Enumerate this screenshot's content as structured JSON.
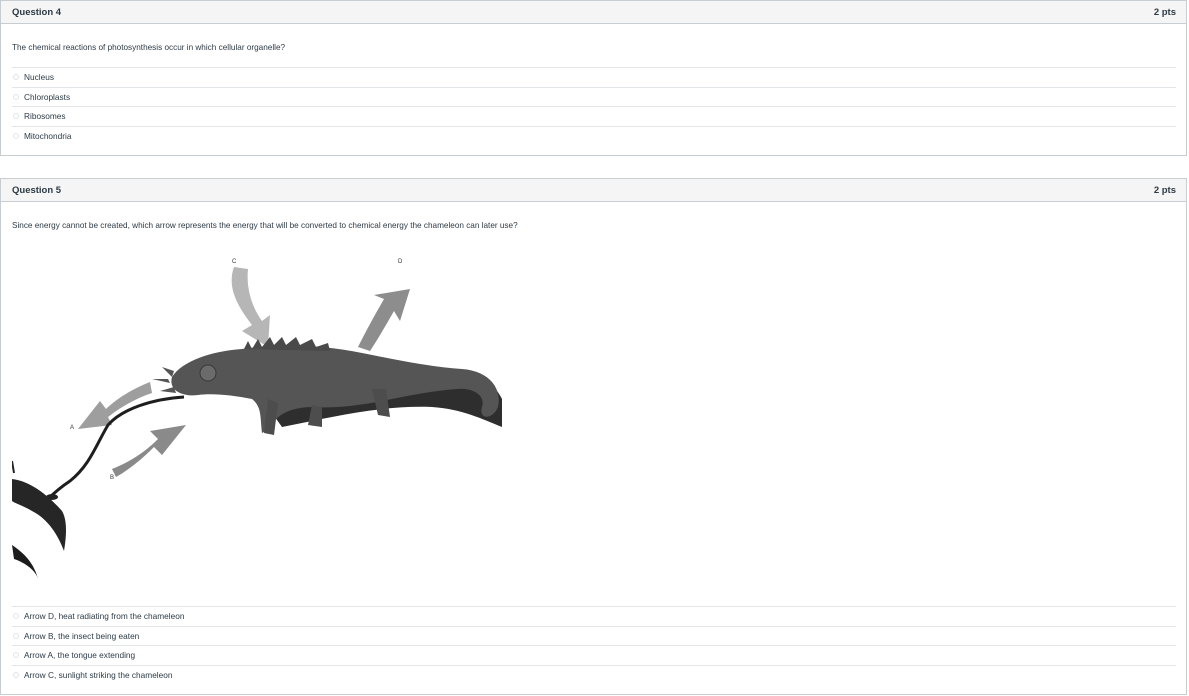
{
  "questions": [
    {
      "title": "Question 4",
      "points": "2 pts",
      "text": "The chemical reactions of photosynthesis occur in which cellular organelle?",
      "answers": [
        "Nucleus",
        "Chloroplasts",
        "Ribosomes",
        "Mitochondria"
      ]
    },
    {
      "title": "Question 5",
      "points": "2 pts",
      "text": "Since energy cannot be created, which arrow represents the energy that will be converted to chemical energy the chameleon can later use?",
      "figure_labels": {
        "a": "A",
        "b": "B",
        "c": "C",
        "d": "D"
      },
      "answers": [
        "Arrow D, heat radiating from the chameleon",
        "Arrow B, the insect being eaten",
        "Arrow A, the tongue extending",
        "Arrow C, sunlight striking the chameleon"
      ]
    }
  ],
  "colors": {
    "header_bg": "#f5f5f5",
    "border": "#c7cdd1",
    "text": "#2d3b45"
  }
}
